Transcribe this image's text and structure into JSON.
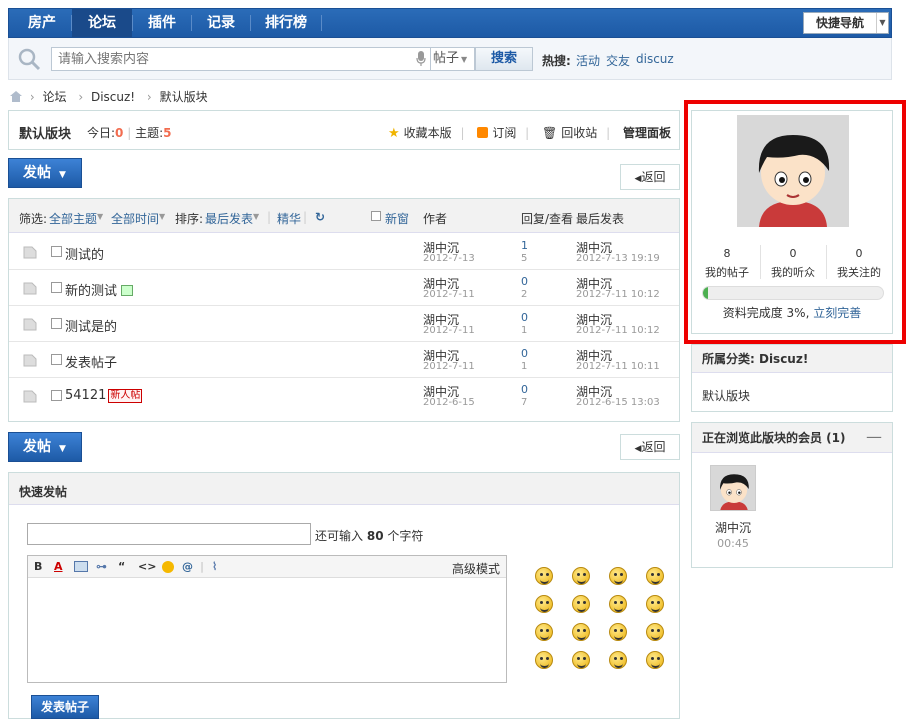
{
  "nav": {
    "items": [
      {
        "label": "房产",
        "active": false
      },
      {
        "label": "论坛",
        "active": true
      },
      {
        "label": "插件",
        "active": false
      },
      {
        "label": "记录",
        "active": false
      },
      {
        "label": "排行榜",
        "active": false
      }
    ],
    "quick_nav_label": "快捷导航"
  },
  "search": {
    "placeholder": "请输入搜索内容",
    "type": "帖子",
    "button": "搜索",
    "hot_label": "热搜:",
    "hot_items": [
      "活动",
      "交友",
      "discuz"
    ]
  },
  "breadcrumb": [
    "论坛",
    "Discuz!",
    "默认版块"
  ],
  "forum": {
    "title": "默认版块",
    "today_label": "今日:",
    "today_count": "0",
    "topic_label": "主题:",
    "topic_count": "5",
    "favorite": "收藏本版",
    "subscribe": "订阅",
    "recycle": "回收站",
    "manage": "管理面板"
  },
  "buttons": {
    "post": "发帖",
    "back": "返回"
  },
  "filters": {
    "label": "筛选:",
    "all_topics": "全部主题",
    "all_time": "全部时间",
    "sort_label": "排序:",
    "sort_value": "最后发表",
    "digest": "精华",
    "new_window": "新窗",
    "col_author": "作者",
    "col_replies": "回复/查看",
    "col_last": "最后发表"
  },
  "threads": [
    {
      "title": "测试的",
      "author": "湖中沉",
      "date": "2012-7-13",
      "replies": "1",
      "views": "5",
      "last_author": "湖中沉",
      "last_date": "2012-7-13 19:19",
      "badge": ""
    },
    {
      "title": "新的测试",
      "author": "湖中沉",
      "date": "2012-7-11",
      "replies": "0",
      "views": "2",
      "last_author": "湖中沉",
      "last_date": "2012-7-11 10:12",
      "badge": "image"
    },
    {
      "title": "测试是的",
      "author": "湖中沉",
      "date": "2012-7-11",
      "replies": "0",
      "views": "1",
      "last_author": "湖中沉",
      "last_date": "2012-7-11 10:12",
      "badge": ""
    },
    {
      "title": "发表帖子",
      "author": "湖中沉",
      "date": "2012-7-11",
      "replies": "0",
      "views": "1",
      "last_author": "湖中沉",
      "last_date": "2012-7-11 10:11",
      "badge": ""
    },
    {
      "title": "54121",
      "author": "湖中沉",
      "date": "2012-6-15",
      "replies": "0",
      "views": "7",
      "last_author": "湖中沉",
      "last_date": "2012-6-15 13:03",
      "badge": "新人帖"
    }
  ],
  "quick_post": {
    "title": "快速发帖",
    "remain_prefix": "还可输入",
    "remain_count": "80",
    "remain_suffix": "个字符",
    "advanced": "高级模式",
    "submit": "发表帖子",
    "smiley_count": 16
  },
  "user_panel": {
    "stats": [
      {
        "num": "8",
        "label": "我的帖子"
      },
      {
        "num": "0",
        "label": "我的听众"
      },
      {
        "num": "0",
        "label": "我关注的"
      }
    ],
    "profile_label": "资料完成度 3%,",
    "profile_link": "立刻完善",
    "profile_percent": 3
  },
  "category": {
    "head": "所属分类: Discuz!",
    "item": "默认版块"
  },
  "online": {
    "head": "正在浏览此版块的会员 (1)",
    "collapse": "—",
    "name": "湖中沉",
    "time": "00:45"
  },
  "colors": {
    "nav_blue": "#1d5aa6",
    "highlight_red": "#ee0000",
    "count_red": "#f26c4f",
    "progress_green": "#4caf50"
  }
}
